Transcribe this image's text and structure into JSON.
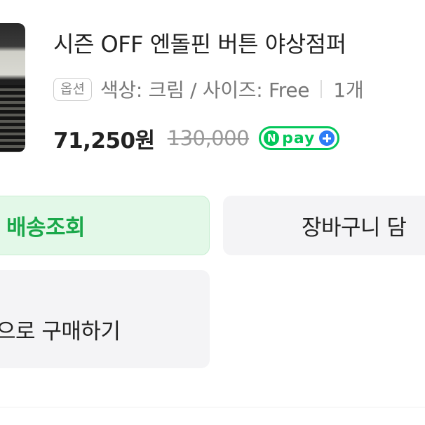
{
  "product": {
    "title": "시즌 OFF 엔돌핀 버튼 야상점퍼",
    "option_badge": "옵션",
    "option_text": "색상: 크림 / 사이즈: Free",
    "quantity": "1개",
    "price": "71,250원",
    "original_price": "130,000",
    "npay_badge": {
      "n": "N",
      "text": "pay"
    }
  },
  "actions": {
    "delivery_label": "배송조회",
    "cart_label": "장바구니 담",
    "buy_label": "으로 구매하기"
  },
  "colors": {
    "brand_green": "#03c75a",
    "delivery_text": "#1aa84a",
    "delivery_bg": "#e3f8e8",
    "button_bg": "#f4f4f6",
    "npay_plus": "#2d7cf6"
  }
}
